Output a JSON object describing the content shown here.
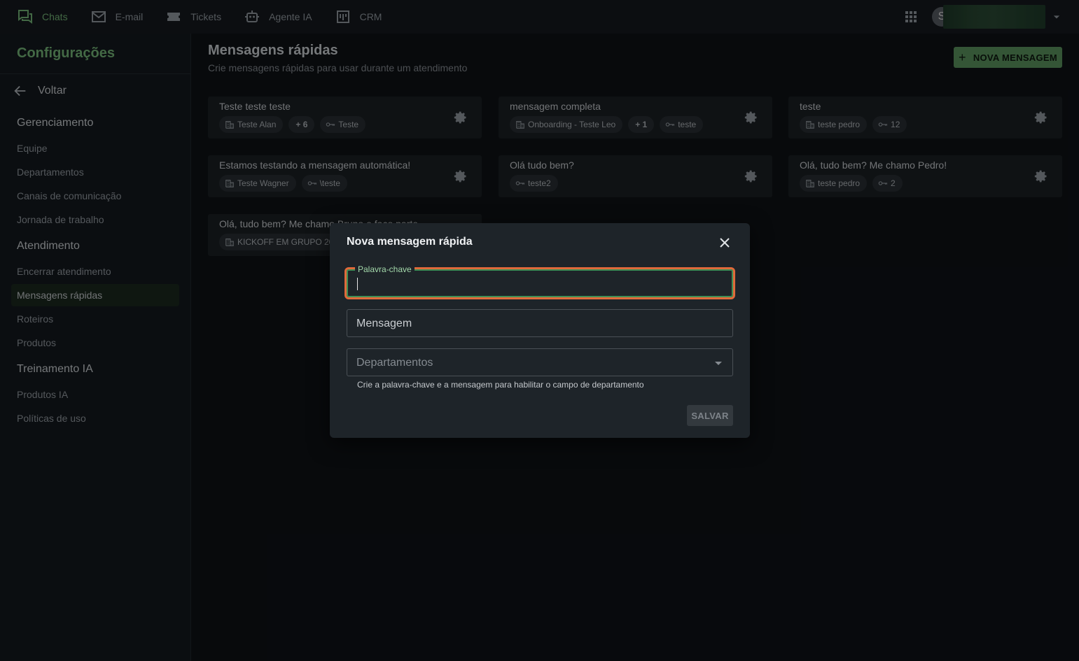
{
  "topnav": {
    "items": [
      {
        "label": "Chats",
        "icon": "chats-icon"
      },
      {
        "label": "E-mail",
        "icon": "mail-icon"
      },
      {
        "label": "Tickets",
        "icon": "ticket-icon"
      },
      {
        "label": "Agente IA",
        "icon": "robot-icon"
      },
      {
        "label": "CRM",
        "icon": "kanban-icon"
      }
    ],
    "avatar_letter": "S"
  },
  "sidebar": {
    "title": "Configurações",
    "back_label": "Voltar",
    "sections": [
      {
        "title": "Gerenciamento",
        "items": [
          "Equipe",
          "Departamentos",
          "Canais de comunicação",
          "Jornada de trabalho"
        ]
      },
      {
        "title": "Atendimento",
        "items": [
          "Encerrar atendimento",
          "Mensagens rápidas",
          "Roteiros",
          "Produtos"
        ]
      },
      {
        "title": "Treinamento IA",
        "items": [
          "Produtos IA",
          "Políticas de uso"
        ]
      }
    ],
    "active_item": "Mensagens rápidas"
  },
  "main": {
    "title": "Mensagens rápidas",
    "subtitle": "Crie mensagens rápidas para usar durante um atendimento",
    "new_button": "NOVA MENSAGEM",
    "cards": [
      {
        "title": "Teste teste teste",
        "department": "Teste Alan",
        "extra": "+ 6",
        "keyword": "Teste"
      },
      {
        "title": "mensagem completa",
        "department": "Onboarding - Teste Leo",
        "extra": "+ 1",
        "keyword": "teste"
      },
      {
        "title": "teste",
        "department": "teste pedro",
        "extra": "",
        "keyword": "12"
      },
      {
        "title": "Estamos testando a mensagem automática!",
        "department": "Teste Wagner",
        "extra": "",
        "keyword": "\\teste"
      },
      {
        "title": "Olá tudo bem?",
        "department": "",
        "extra": "",
        "keyword": "teste2"
      },
      {
        "title": "Olá, tudo bem? Me chamo Pedro!",
        "department": "teste pedro",
        "extra": "",
        "keyword": "2"
      },
      {
        "title": "Olá, tudo bem? Me chamo Bruno e faço parte",
        "department": "KICKOFF EM GRUPO 20",
        "extra": "",
        "keyword": ""
      }
    ]
  },
  "dialog": {
    "title": "Nova mensagem rápida",
    "keyword_label": "Palavra-chave",
    "keyword_value": "",
    "message_placeholder": "Mensagem",
    "departments_placeholder": "Departamentos",
    "helper": "Crie a palavra-chave e a mensagem para habilitar o campo de departamento",
    "save_label": "SALVAR"
  },
  "colors": {
    "accent": "#7bbf7e",
    "button": "#5f9b63",
    "focus_outline": "#e06a3a"
  }
}
